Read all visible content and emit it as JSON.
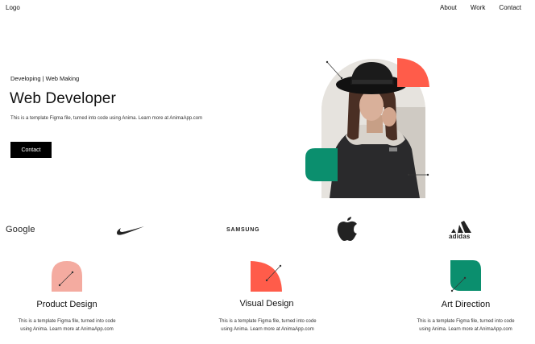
{
  "header": {
    "logo": "Logo",
    "nav": [
      "About",
      "Work",
      "Contact"
    ]
  },
  "hero": {
    "subtitle": "Developing | Web Making",
    "title": "Web Developer",
    "description": "This is a template Figma file, turned into code using Anima. Learn more at AnimaApp.com",
    "cta_label": "Contact"
  },
  "brands": {
    "google": "Google",
    "nike": "nike-swoosh-icon",
    "samsung": "SAMSUNG",
    "apple": "apple-icon",
    "adidas": "adidas"
  },
  "services": [
    {
      "title": "Product Design",
      "description_line1": "This is a template Figma file, turned into code",
      "description_line2": "using Anima. Learn more at AnimaApp.com"
    },
    {
      "title": "Visual Design",
      "description_line1": "This is a template Figma file, turned into code",
      "description_line2": "using Anima. Learn more at AnimaApp.com"
    },
    {
      "title": "Art Direction",
      "description_line1": "This is a template Figma file, turned into code",
      "description_line2": "using Anima. Learn more at AnimaApp.com"
    }
  ],
  "colors": {
    "accent_orange": "#ff5c4a",
    "accent_green": "#0b8f6e",
    "accent_pink": "#f4aba0",
    "button_bg": "#000000"
  }
}
